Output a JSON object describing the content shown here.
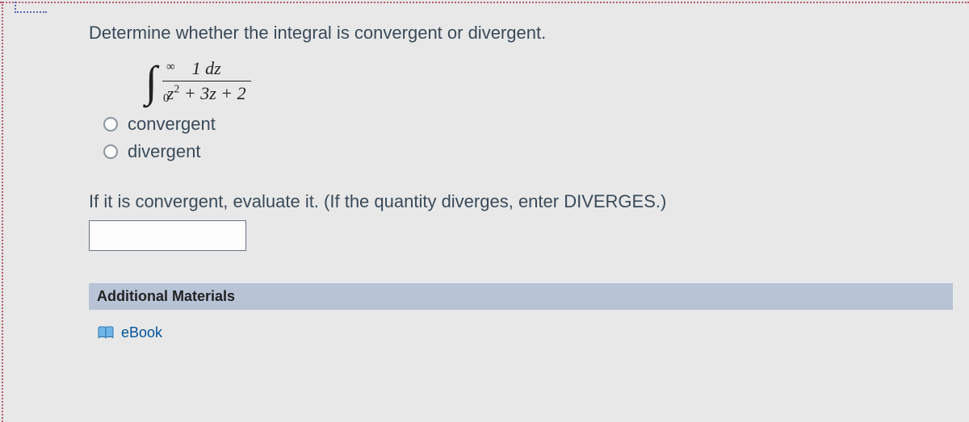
{
  "question": {
    "prompt": "Determine whether the integral is convergent or divergent.",
    "integral": {
      "lower": "0",
      "upper": "∞",
      "numerator": "1 dz",
      "denominator_prefix": "z",
      "denominator_exp": "2",
      "denominator_suffix": " + 3z + 2"
    },
    "options": [
      {
        "label": "convergent"
      },
      {
        "label": "divergent"
      }
    ],
    "followup": "If it is convergent, evaluate it. (If the quantity diverges, enter DIVERGES.)",
    "answer_value": ""
  },
  "materials": {
    "header": "Additional Materials",
    "ebook": "eBook"
  }
}
